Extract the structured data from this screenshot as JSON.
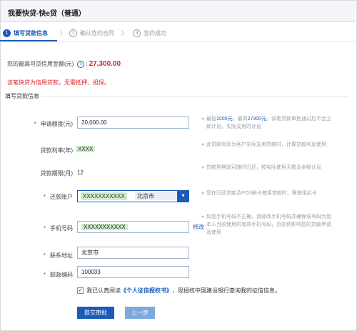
{
  "window": {
    "title": "我要快贷-快e贷（普通）"
  },
  "steps": [
    {
      "num": "1",
      "label": "填写贷款信息"
    },
    {
      "num": "2",
      "label": "确认签约合同"
    },
    {
      "num": "3",
      "label": "签约成功"
    }
  ],
  "step_separator": "〉",
  "limit": {
    "label": "您的最高可贷信用金额(元)",
    "colon": ":",
    "amount": "27,300.00"
  },
  "notice": "该笔快贷为信用贷款，无需抵押、担保。",
  "section_title": "填写贷款信息",
  "form": {
    "amount": {
      "label": "申请额度(元)",
      "value": "20,000.00"
    },
    "rate": {
      "label": "贷款利率(年)",
      "value": "XXXX"
    },
    "term": {
      "label": "贷款期限(月)",
      "value": "12"
    },
    "account": {
      "label": "还款账户",
      "value": "XXXXXXXXXXX",
      "city": "北京市"
    },
    "phone": {
      "label": "手机号码",
      "value": "XXXXXXXXXXX",
      "modify": "修改"
    },
    "address": {
      "label": "联系地址",
      "value": "北京市"
    },
    "zip": {
      "label": "邮政编码",
      "value": "100033"
    }
  },
  "tips": {
    "t1_pre": "最低",
    "t1_min": "1000元",
    "t1_mid": "，最高",
    "t1_max": "27300元",
    "t1_post": "。该笔贷款审批通过后不会立即计息，实际支用时计息",
    "t2": "此贷款利率为客户实际支用贷款时，计算贷款利息使用",
    "t3": "贷款到期前可随时归还，按实际使用天数及金额计息",
    "t4": "您在归还贷款及POS刷卡使用贷款时，需使用此卡",
    "t5": "如您手机号码不正确，请修改手机号码并确保该号码为您本人当前使用的有效手机号码，否则将影响您的贷款申请及使用"
  },
  "agreement": {
    "check": "✓",
    "pre": "我已认真阅读",
    "link": "《个人征信授权书》",
    "post": "，现授权中国建设银行查询我的征信信息。"
  },
  "buttons": {
    "submit": "提交审批",
    "back": "上一步"
  }
}
